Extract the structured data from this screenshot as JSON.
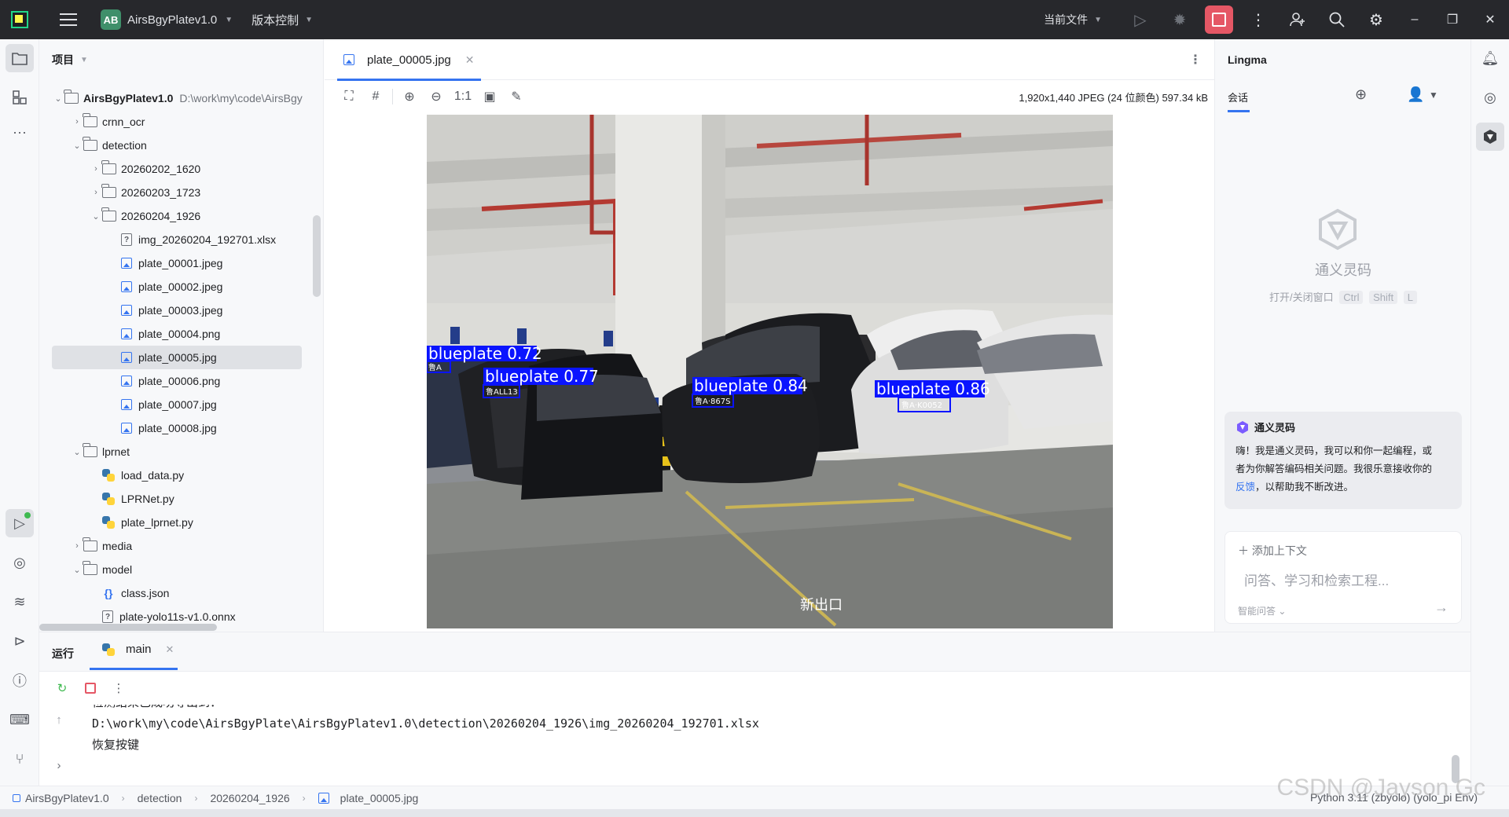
{
  "titlebar": {
    "project_badge": "AB",
    "project_name": "AirsBgyPlatev1.0",
    "vcs": "版本控制",
    "run_config": "当前文件"
  },
  "project_panel": {
    "title": "项目",
    "root_name": "AirsBgyPlatev1.0",
    "root_path": "D:\\work\\my\\code\\AirsBgy",
    "items": [
      {
        "label": "crnn_ocr"
      },
      {
        "label": "detection"
      },
      {
        "label": "20260202_1620"
      },
      {
        "label": "20260203_1723"
      },
      {
        "label": "20260204_1926"
      },
      {
        "label": "img_20260204_192701.xlsx"
      },
      {
        "label": "plate_00001.jpeg"
      },
      {
        "label": "plate_00002.jpeg"
      },
      {
        "label": "plate_00003.jpeg"
      },
      {
        "label": "plate_00004.png"
      },
      {
        "label": "plate_00005.jpg"
      },
      {
        "label": "plate_00006.png"
      },
      {
        "label": "plate_00007.jpg"
      },
      {
        "label": "plate_00008.jpg"
      },
      {
        "label": "lprnet"
      },
      {
        "label": "load_data.py"
      },
      {
        "label": "LPRNet.py"
      },
      {
        "label": "plate_lprnet.py"
      },
      {
        "label": "media"
      },
      {
        "label": "model"
      },
      {
        "label": "class.json"
      },
      {
        "label": "plate-yolo11s-v1.0.onnx"
      }
    ]
  },
  "editor": {
    "tab_label": "plate_00005.jpg",
    "zoom_label": "1:1",
    "image_info": "1,920x1,440 JPEG (24 位颜色) 597.34 kB",
    "detections": [
      {
        "label": "blueplate  0.72",
        "plate": "鲁A"
      },
      {
        "label": "blueplate  0.77",
        "plate": "鲁ALL13"
      },
      {
        "label": "blueplate  0.84",
        "plate": "鲁A·867S"
      },
      {
        "label": "blueplate  0.86",
        "plate": "鲁A·K0052"
      }
    ],
    "photo_sign": "新出口"
  },
  "ai_panel": {
    "title": "Lingma",
    "tab": "会话",
    "brand": "通义灵码",
    "shortcut_label": "打开/关闭窗口",
    "keys": [
      "Ctrl",
      "Shift",
      "L"
    ],
    "msg_title": "通义灵码",
    "msg_line1": "嗨！我是通义灵码，我可以和你一起编程，或",
    "msg_line2": "者为你解答编码相关问题。我很乐意接收你的",
    "msg_link": "反馈",
    "msg_line3": "，以帮助我不断改进。",
    "add_context": "添加上下文",
    "placeholder": "问答、学习和检索工程...",
    "mode": "智能问答"
  },
  "run_panel": {
    "title": "运行",
    "tab": "main",
    "lines": [
      "检测结果已成功导出到：",
      "D:\\work\\my\\code\\AirsBgyPlate\\AirsBgyPlatev1.0\\detection\\20260204_1926\\img_20260204_192701.xlsx",
      "恢复按键"
    ]
  },
  "statusbar": {
    "crumbs": [
      "AirsBgyPlatev1.0",
      "detection",
      "20260204_1926",
      "plate_00005.jpg"
    ],
    "interpreter": "Python 3.11 (zbyolo) (yolo_pi Env)"
  },
  "watermark": "CSDN @Jayson Gc",
  "colors": {
    "accent": "#3574f0",
    "titlebar": "#27282c",
    "stop": "#e55765",
    "detection_box": "#0a14ff"
  }
}
